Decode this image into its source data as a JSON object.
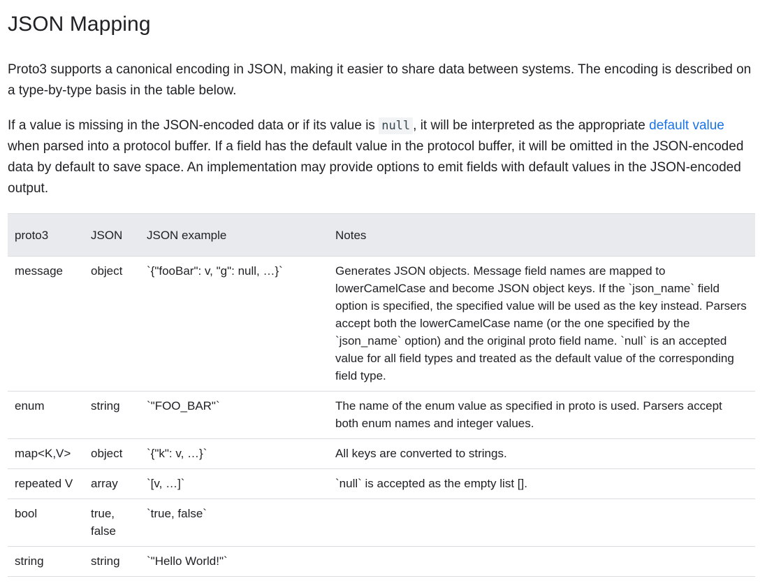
{
  "page": {
    "title": "JSON Mapping",
    "para1": "Proto3 supports a canonical encoding in JSON, making it easier to share data between systems. The encoding is described on a type-by-type basis in the table below.",
    "para2": {
      "before_code": "If a value is missing in the JSON-encoded data or if its value is ",
      "code": "null",
      "after_code": ", it will be interpreted as the appropriate ",
      "link": "default value",
      "after_link": " when parsed into a protocol buffer. If a field has the default value in the protocol buffer, it will be omitted in the JSON-encoded data by default to save space. An implementation may provide options to emit fields with default values in the JSON-encoded output."
    }
  },
  "table": {
    "headers": [
      "proto3",
      "JSON",
      "JSON example",
      "Notes"
    ],
    "rows": [
      {
        "proto3": "message",
        "json": "object",
        "example": "`{\"fooBar\": v, \"g\": null, …}`",
        "notes": "Generates JSON objects. Message field names are mapped to lowerCamelCase and become JSON object keys. If the `json_name` field option is specified, the specified value will be used as the key instead. Parsers accept both the lowerCamelCase name (or the one specified by the `json_name` option) and the original proto field name. `null` is an accepted value for all field types and treated as the default value of the corresponding field type."
      },
      {
        "proto3": "enum",
        "json": "string",
        "example": "`\"FOO_BAR\"`",
        "notes": "The name of the enum value as specified in proto is used. Parsers accept both enum names and integer values."
      },
      {
        "proto3": "map<K,V>",
        "json": "object",
        "example": "`{\"k\": v, …}`",
        "notes": "All keys are converted to strings."
      },
      {
        "proto3": "repeated V",
        "json": "array",
        "example": "`[v, …]`",
        "notes": "`null` is accepted as the empty list []."
      },
      {
        "proto3": "bool",
        "json": "true, false",
        "example": "`true, false`",
        "notes": ""
      },
      {
        "proto3": "string",
        "json": "string",
        "example": "`\"Hello World!\"`",
        "notes": ""
      }
    ]
  }
}
